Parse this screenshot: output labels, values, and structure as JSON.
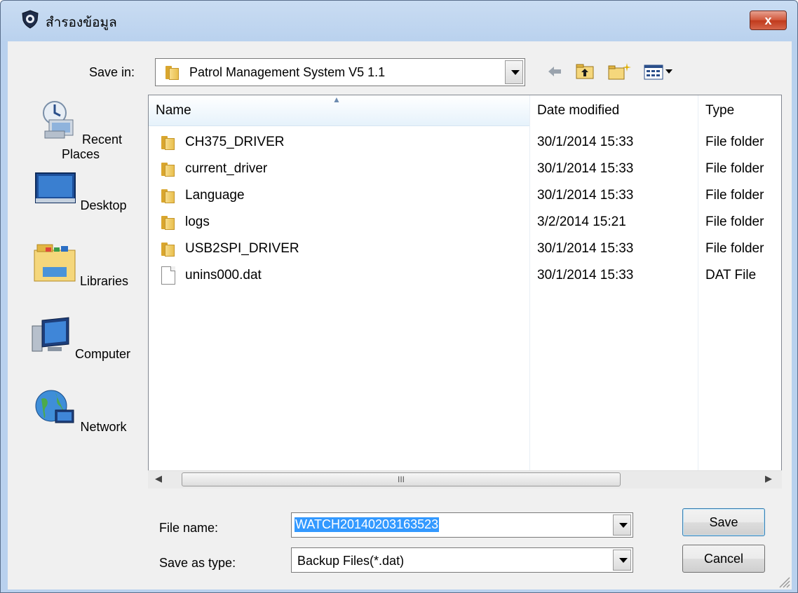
{
  "window": {
    "title": "สำรองข้อมูล",
    "close_label": "x"
  },
  "save_in": {
    "label": "Save in:",
    "value": "Patrol Management System V5 1.1"
  },
  "toolbar": {
    "icons": [
      "back-arrow-icon",
      "up-folder-icon",
      "new-folder-icon",
      "view-menu-icon"
    ]
  },
  "places": [
    {
      "label": "Recent Places",
      "icon": "recent-places-icon"
    },
    {
      "label": "Desktop",
      "icon": "desktop-icon"
    },
    {
      "label": "Libraries",
      "icon": "libraries-icon"
    },
    {
      "label": "Computer",
      "icon": "computer-icon"
    },
    {
      "label": "Network",
      "icon": "network-icon"
    }
  ],
  "file_list": {
    "columns": [
      "Name",
      "Date modified",
      "Type"
    ],
    "sorted_column": "Name",
    "rows": [
      {
        "name": "CH375_DRIVER",
        "date": "30/1/2014 15:33",
        "type": "File folder",
        "icon": "folder-icon"
      },
      {
        "name": "current_driver",
        "date": "30/1/2014 15:33",
        "type": "File folder",
        "icon": "folder-icon"
      },
      {
        "name": "Language",
        "date": "30/1/2014 15:33",
        "type": "File folder",
        "icon": "folder-icon"
      },
      {
        "name": "logs",
        "date": "3/2/2014 15:21",
        "type": "File folder",
        "icon": "folder-icon"
      },
      {
        "name": "USB2SPI_DRIVER",
        "date": "30/1/2014 15:33",
        "type": "File folder",
        "icon": "folder-icon"
      },
      {
        "name": "unins000.dat",
        "date": "30/1/2014 15:33",
        "type": "DAT File",
        "icon": "file-icon"
      }
    ],
    "scroll_thumb_label": "III"
  },
  "file_name": {
    "label": "File name:",
    "value": "WATCH20140203163523"
  },
  "save_as_type": {
    "label": "Save as type:",
    "value": "Backup Files(*.dat)"
  },
  "buttons": {
    "save": "Save",
    "cancel": "Cancel"
  },
  "colors": {
    "selection": "#3399ff",
    "title_gradient": "#b9d1ee",
    "close_red": "#c03a1c"
  }
}
